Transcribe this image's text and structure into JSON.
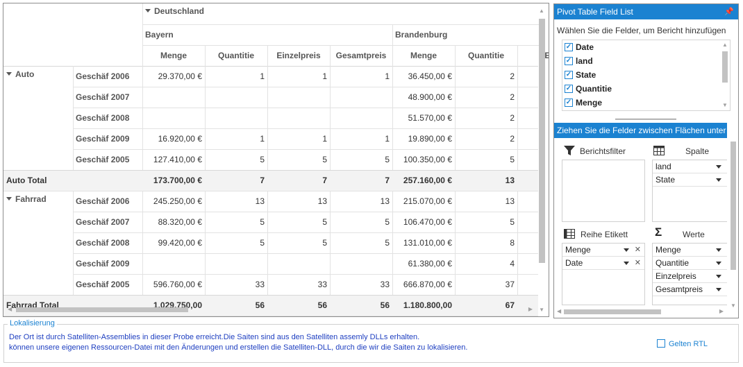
{
  "grid": {
    "col_header_top": "Deutschland",
    "regions": [
      "Bayern",
      "Brandenburg"
    ],
    "measures": [
      "Menge",
      "Quantitie",
      "Einzelpreis",
      "Gesamtpreis",
      "Menge",
      "Quantitie",
      "Ei"
    ],
    "groups": [
      {
        "label": "Auto",
        "rows": [
          {
            "label": "Geschäf 2006",
            "values": [
              "29.370,00 €",
              "1",
              "1",
              "1",
              "36.450,00 €",
              "2"
            ]
          },
          {
            "label": "Geschäf 2007",
            "values": [
              "",
              "",
              "",
              "",
              "48.900,00 €",
              "2"
            ]
          },
          {
            "label": "Geschäf 2008",
            "values": [
              "",
              "",
              "",
              "",
              "51.570,00 €",
              "2"
            ]
          },
          {
            "label": "Geschäf 2009",
            "values": [
              "16.920,00 €",
              "1",
              "1",
              "1",
              "19.890,00 €",
              "2"
            ]
          },
          {
            "label": "Geschäf 2005",
            "values": [
              "127.410,00 €",
              "5",
              "5",
              "5",
              "100.350,00 €",
              "5"
            ]
          }
        ],
        "total_label": "Auto Total",
        "total_values": [
          "173.700,00 €",
          "7",
          "7",
          "7",
          "257.160,00 €",
          "13"
        ]
      },
      {
        "label": "Fahrrad",
        "rows": [
          {
            "label": "Geschäf 2006",
            "values": [
              "245.250,00 €",
              "13",
              "13",
              "13",
              "215.070,00 €",
              "13"
            ]
          },
          {
            "label": "Geschäf 2007",
            "values": [
              "88.320,00 €",
              "5",
              "5",
              "5",
              "106.470,00 €",
              "5"
            ]
          },
          {
            "label": "Geschäf 2008",
            "values": [
              "99.420,00 €",
              "5",
              "5",
              "5",
              "131.010,00 €",
              "8"
            ]
          },
          {
            "label": "Geschäf 2009",
            "values": [
              "",
              "",
              "",
              "",
              "61.380,00 €",
              "4"
            ]
          },
          {
            "label": "Geschäf 2005",
            "values": [
              "596.760,00 €",
              "33",
              "33",
              "33",
              "666.870,00 €",
              "37"
            ]
          }
        ],
        "total_label": "Fahrrad Total",
        "total_values": [
          "1.029.750,00",
          "56",
          "56",
          "56",
          "1.180.800,00",
          "67"
        ]
      }
    ]
  },
  "panel": {
    "title": "Pivot Table Field List",
    "instruction": "Wählen Sie die Felder, um Bericht hinzufügen",
    "fields": [
      "Date",
      "land",
      "State",
      "Quantitie",
      "Menge"
    ],
    "drag_title": "Ziehen Sie die Felder zwischen Flächen unter",
    "filter_label": "Berichtsfilter",
    "columns_label": "Spalte",
    "columns": [
      "land",
      "State"
    ],
    "rows_label": "Reihe Etikett",
    "rows": [
      "Menge",
      "Date"
    ],
    "values_label": "Werte",
    "values": [
      "Menge",
      "Quantitie",
      "Einzelpreis",
      "Gesamtpreis"
    ]
  },
  "localization": {
    "legend": "Lokalisierung",
    "line1": "Der Ort ist durch Satelliten-Assemblies in dieser Probe erreicht.Die Saiten sind aus den Satelliten assemly DLLs erhalten.",
    "line2": "können unsere eigenen Ressourcen-Datei mit den Änderungen und erstellen die Satelliten-DLL, durch die wir die Saiten zu lokalisieren.",
    "rtl_label": "Gelten RTL"
  },
  "colors": {
    "accent": "#1b82d1",
    "info_text": "#1d3ec0"
  }
}
